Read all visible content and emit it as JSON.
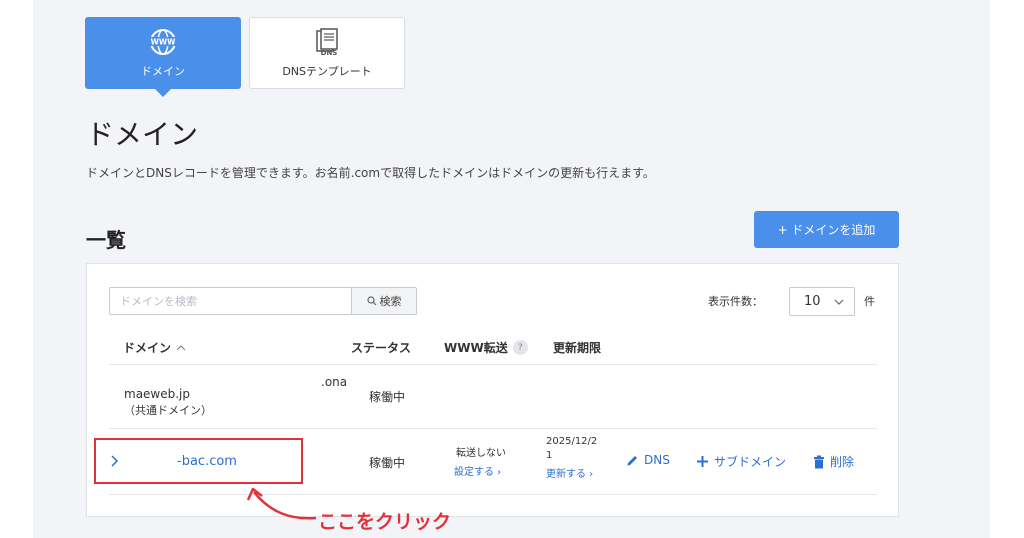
{
  "tabs": [
    {
      "label": "ドメイン",
      "icon": "www-globe-icon",
      "active": true
    },
    {
      "label": "DNSテンプレート",
      "icon": "dns-document-icon",
      "active": false
    }
  ],
  "page_title": "ドメイン",
  "page_description": "ドメインとDNSレコードを管理できます。お名前.comで取得したドメインはドメインの更新も行えます。",
  "list_title": "一覧",
  "add_button": "+ ドメインを追加",
  "search": {
    "placeholder": "ドメインを検索",
    "button": "検索"
  },
  "per_page": {
    "label": "表示件数：",
    "value": "10",
    "unit": "件"
  },
  "columns": {
    "domain": "ドメイン",
    "status": "ステータス",
    "www": "WWW転送",
    "expiry": "更新期限"
  },
  "rows": [
    {
      "domain": "maeweb.jp",
      "note": "（共通ドメイン）",
      "extra": ".ona",
      "status": "稼働中"
    },
    {
      "domain": "-bac.com",
      "status": "稼働中",
      "www_status": "転送しない",
      "www_link": "設定する ›",
      "expiry_date_line1": "2025/12/2",
      "expiry_date_line2": "1",
      "expiry_link": "更新する ›",
      "actions": {
        "dns": "DNS",
        "subdomain": "サブドメイン",
        "delete": "削除"
      }
    }
  ],
  "annotation": "ここをクリック",
  "colors": {
    "accent": "#4a8fe9",
    "link": "#2b6fd0",
    "annotation": "#e0323a",
    "background": "#f3f4f7"
  }
}
